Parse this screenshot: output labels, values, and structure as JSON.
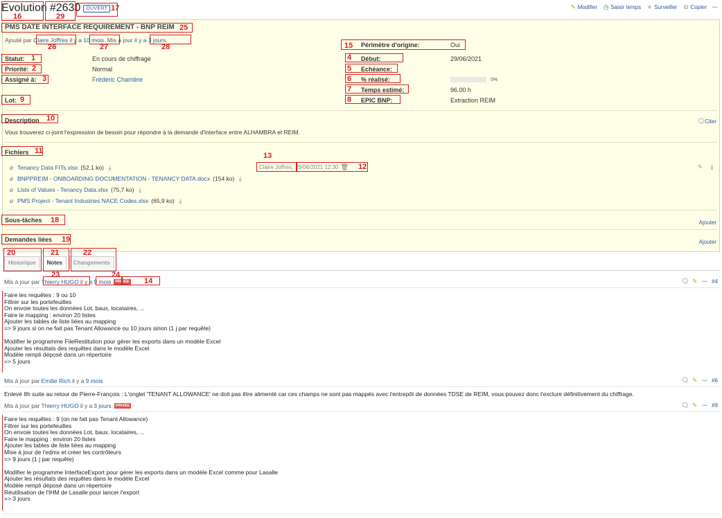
{
  "header": {
    "tracker": "Evolution",
    "id": "#2630",
    "status": "OUVERT",
    "actions": [
      {
        "label": "Modifier",
        "icon": "pencil-icon"
      },
      {
        "label": "Saisir temps",
        "icon": "clock-icon"
      },
      {
        "label": "Surveiller",
        "icon": "star-icon"
      },
      {
        "label": "Copier",
        "icon": "copy-icon"
      }
    ],
    "more": "···"
  },
  "issue": {
    "subject": "PMS DATE INTERFACE REQUIREMENT - BNP REIM",
    "author_prefix": "Ajouté par",
    "author": "Claire Joffres",
    "added_prefix": "il y a",
    "added_ago": "10 mois.",
    "updated_prefix": "Mis à jour",
    "updated_ago": "il y a 3 jours.",
    "attributes_left": [
      {
        "label": "Statut:",
        "value": "En cours de chiffrage"
      },
      {
        "label": "Priorité:",
        "value": "Normal"
      },
      {
        "label": "Assigné à:",
        "value": "Frédéric Charrière"
      },
      {
        "label": "Lot:",
        "value": ""
      }
    ],
    "perimetre": {
      "label": "Périmètre d'origine:",
      "value": "Oui"
    },
    "attributes_right": [
      {
        "label": "Début:",
        "value": "29/06/2021"
      },
      {
        "label": "Echéance:",
        "value": ""
      },
      {
        "label": "% réalisé:",
        "value": "0%"
      },
      {
        "label": "Temps estimé:",
        "value": "96.00 h"
      },
      {
        "label": "EPIC BNP:",
        "value": "Extraction REIM"
      }
    ],
    "done_ratio": 0,
    "description_title": "Description",
    "cite_label": "Citer",
    "description": "Vous trouverez ci-joint l'expression de besoin pour répondre à la demande d'interface entre ALHAMBRA et REIM.",
    "files_title": "Fichiers",
    "files_author": "Claire Joffres,",
    "files_date": "29/06/2021 12:30",
    "files": [
      {
        "name": "Tenancy Data FITs.xlsx",
        "size": "(52,1 ko)"
      },
      {
        "name": "BNPPREIM - ONBOARDING DOCUMENTATION - TENANCY DATA.docx",
        "size": "(154 ko)"
      },
      {
        "name": "Lists of Values - Tenancy Data.xlsx",
        "size": "(75,7 ko)"
      },
      {
        "name": "PMS Project - Tenant Industries NACE Codes.xlsx",
        "size": "(65,9 ko)"
      }
    ],
    "subtasks_title": "Sous-tâches",
    "related_title": "Demandes liées",
    "add_label": "Ajouter"
  },
  "tabs": [
    {
      "label": "Historique",
      "active": false
    },
    {
      "label": "Notes",
      "active": true
    },
    {
      "label": "Changements",
      "active": false
    }
  ],
  "journals": [
    {
      "prefix": "Mis à jour par",
      "user": "Thierry HUGO",
      "ago_prefix": "il y a",
      "ago": "9 mois",
      "private": "PRIVÉE",
      "number": "#4",
      "lines": [
        "Faire les requêtes : 9 ou 10",
        "Filtrer sur les portefeuilles",
        "On envoie toutes les données Lot, baux, locataires, ...",
        "Faire le mapping : environ 20 listes",
        "Ajouter les tables de liste liées au mapping",
        "=> 9 jours si on ne fait pas Tenant Allowance ou 10 jours sinon (1 j par requête)",
        "",
        "Modifier le programme FileRestitution pour gérer les exports dans un modèle Excel",
        "Ajouter les résultats des requêtes dans le modèle Excel",
        "Modèle rempli déposé dans un répertoire",
        "=> 5 jours"
      ]
    },
    {
      "prefix": "Mis à jour par",
      "user": "Emilie Rich",
      "ago_prefix": "il y a",
      "ago": "9 mois",
      "private": "",
      "number": "#6",
      "lines": [
        "Enlevé 8h suite au retour de Pierre-François : L'onglet 'TENANT ALLOWANCE' ne doit pas être alimenté car ces champs ne sont pas mappés avec l'entrepôt de données TDSE de REIM, vous pouvez donc l'exclure définitivement du chiffrage."
      ]
    },
    {
      "prefix": "Mis à jour par",
      "user": "Thierry HUGO",
      "ago_prefix": "il y a",
      "ago": "3 jours",
      "private": "PRIVÉE",
      "number": "#9",
      "lines": [
        "Faire les requêtes : 9 (on ne fait pas Tenant Allowance)",
        "Filtrer sur les portefeuilles",
        "On envoie toutes les données Lot, baux, locataires, ...",
        "Faire le mapping : environ 20 listes",
        "Ajouter les tables de liste liées au mapping",
        "Mise à jour de l'edmx et créer les contrôleurs",
        "=> 9 jours (1 j par requête)",
        "",
        "Modifier le programme InterfaceExport pour gérer les exports dans un modèle Excel comme pour Lasalle",
        "Ajouter les résultats des requêtes dans le modèle Excel",
        "Modèle rempli déposé dans un répertoire",
        "Réutilisation de l'IHM de Lasalle pour lancer l'export",
        "=> 3 jours"
      ]
    }
  ],
  "annotations": [
    "1",
    "2",
    "3",
    "4",
    "5",
    "6",
    "7",
    "8",
    "9",
    "10",
    "11",
    "12",
    "13",
    "14",
    "15",
    "16",
    "17",
    "18",
    "19",
    "20",
    "21",
    "22",
    "23",
    "24",
    "25",
    "26",
    "27",
    "28",
    "29"
  ]
}
